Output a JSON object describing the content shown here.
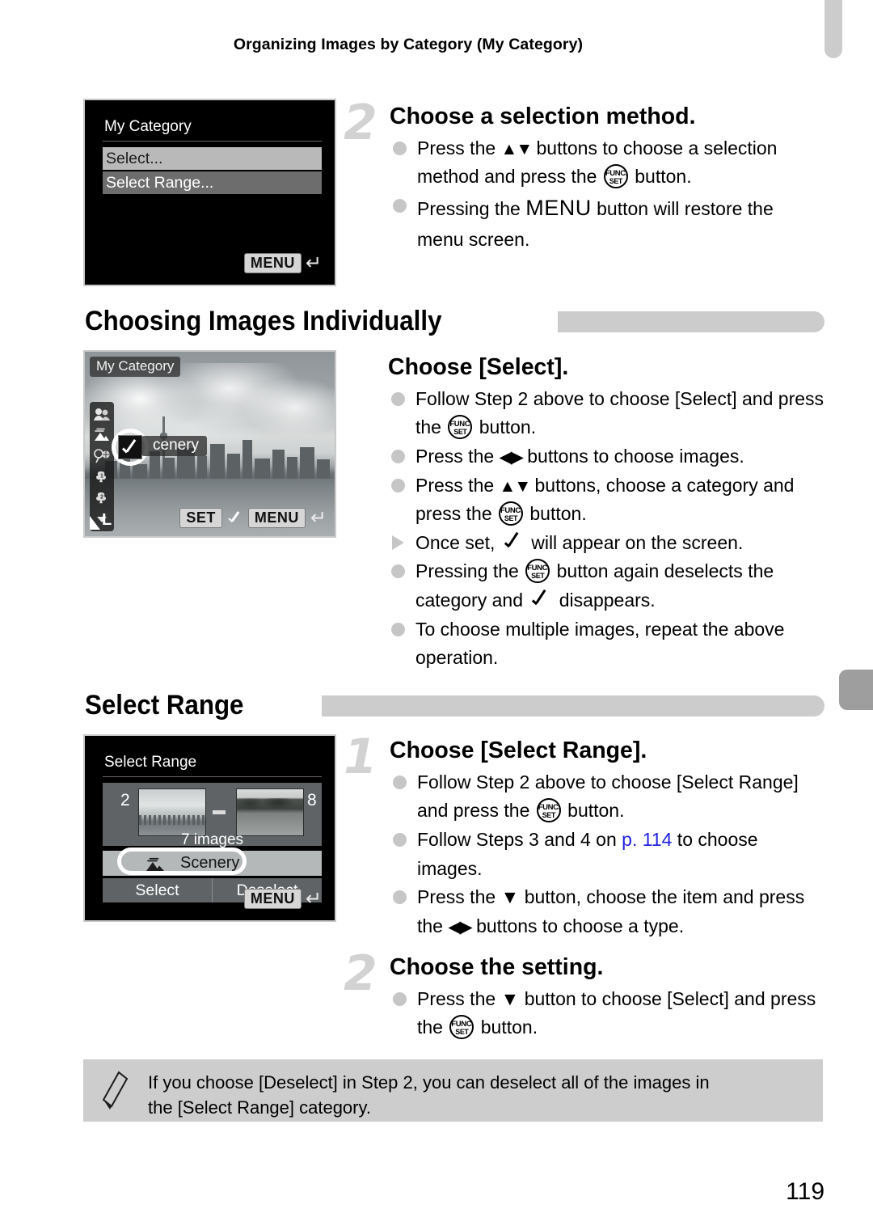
{
  "header": {
    "running_title": "Organizing Images by Category (My Category)"
  },
  "page_number": "119",
  "step2_top": {
    "number": "2",
    "heading": "Choose a selection method.",
    "bullets": [
      {
        "marker": "circle",
        "parts": [
          "Press the ",
          "updown",
          " buttons to choose a selection method and press the ",
          "funcset",
          " button."
        ]
      },
      {
        "marker": "circle",
        "parts": [
          "Pressing the ",
          "menu",
          " button will restore the menu screen."
        ]
      }
    ]
  },
  "screen_menu": {
    "title": "My Category",
    "rows": [
      {
        "label": "Select...",
        "state": "selected"
      },
      {
        "label": "Select Range...",
        "state": "normal"
      }
    ],
    "menu_badge": "MENU",
    "return_glyph": "return-arrow"
  },
  "section_individually": {
    "title": "Choosing Images Individually"
  },
  "screen_photo": {
    "category_badge": "My Category",
    "scenery_label": "cenery",
    "icons": [
      "people-icon",
      "scenery-icon",
      "events-icon",
      "category1-icon",
      "category2-icon",
      "down-arrow-icon"
    ],
    "quality_label": "L",
    "bottom_bar": {
      "set_badge": "SET",
      "check": "check-icon",
      "menu_badge": "MENU",
      "return_glyph": "return-arrow"
    }
  },
  "choose_select": {
    "heading": "Choose [Select].",
    "bullets": [
      {
        "marker": "circle",
        "parts": [
          "Follow Step 2 above to choose [Select] and press the ",
          "funcset",
          " button."
        ]
      },
      {
        "marker": "circle",
        "parts": [
          "Press the ",
          "leftright",
          " buttons to choose images."
        ]
      },
      {
        "marker": "circle",
        "parts": [
          "Press the ",
          "updown",
          " buttons, choose a category and press the ",
          "funcset",
          " button."
        ]
      },
      {
        "marker": "triangle",
        "parts": [
          "Once set, ",
          "check",
          " will appear on the screen."
        ]
      },
      {
        "marker": "circle",
        "parts": [
          "Pressing the ",
          "funcset",
          " button again deselects the category and ",
          "check",
          " disappears."
        ]
      },
      {
        "marker": "circle",
        "parts": [
          "To choose multiple images, repeat the above operation."
        ]
      }
    ]
  },
  "section_select_range": {
    "title": "Select Range"
  },
  "screen_select_range": {
    "title": "Select Range",
    "start_number": "2",
    "end_number": "8",
    "image_count": "7 images",
    "category_row": "Scenery",
    "buttons": [
      "Select",
      "Deselect"
    ],
    "menu_badge": "MENU",
    "return_glyph": "return-arrow"
  },
  "step1_range": {
    "number": "1",
    "heading": "Choose [Select Range].",
    "bullets": [
      {
        "marker": "circle",
        "parts": [
          "Follow Step 2 above to choose [Select Range] and press the ",
          "funcset",
          " button."
        ]
      },
      {
        "marker": "circle",
        "parts": [
          "Follow Steps 3 and 4 on ",
          "link:p. 114",
          " to choose images."
        ]
      },
      {
        "marker": "circle",
        "parts": [
          "Press the ",
          "down",
          " button, choose the item and press the ",
          "leftright",
          " buttons to choose a type."
        ]
      }
    ],
    "link_text": "p. 114"
  },
  "step2_range": {
    "number": "2",
    "heading": "Choose the setting.",
    "bullets": [
      {
        "marker": "circle",
        "parts": [
          "Press the ",
          "down",
          " button to choose [Select] and press the ",
          "funcset",
          " button."
        ]
      }
    ]
  },
  "note": {
    "icon": "pencil-icon",
    "line1": "If you choose [Deselect] in Step 2, you can deselect all of the images in",
    "line2": "the [Select Range] category."
  },
  "colors": {
    "link": "#2222dd",
    "bar_gray": "#cccccc",
    "note_bg": "#cdcdcd",
    "step_number_gray": "#d2d2d2"
  }
}
